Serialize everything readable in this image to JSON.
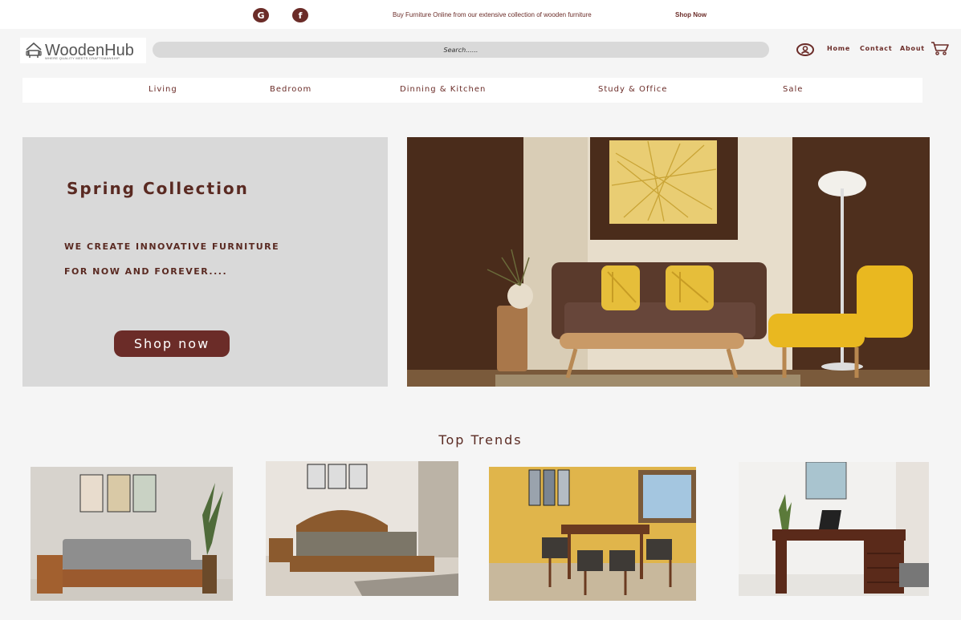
{
  "topbar": {
    "social": [
      {
        "icon": "google-icon",
        "glyph": "G"
      },
      {
        "icon": "facebook-icon",
        "glyph": "f"
      }
    ],
    "promo_text": "Buy Furniture Online from our extensive collection of wooden furniture",
    "shop_now": "Shop Now"
  },
  "header": {
    "logo_text": "WoodenHub",
    "logo_tagline": "WHERE QUALITY MEETS CRAFTSMANSHIP",
    "search_placeholder": "Search......",
    "user_icon": "user-icon",
    "nav": {
      "home": "Home",
      "contact": "Contact",
      "about": "About"
    },
    "cart_icon": "cart-icon"
  },
  "categories": [
    "Living",
    "Bedroom",
    "Dinning & Kitchen",
    "Study & Office",
    "Sale"
  ],
  "hero": {
    "title": "Spring Collection",
    "line1": "WE CREATE INNOVATIVE FURNITURE",
    "line2": "FOR NOW AND FOREVER....",
    "button": "Shop now"
  },
  "trends": {
    "title": "Top Trends",
    "items": [
      "wooden-sofa-image",
      "wooden-bed-image",
      "dining-set-image",
      "study-desk-image"
    ]
  },
  "colors": {
    "brand": "#6b2c28",
    "panel": "#d9d9d9",
    "background": "#f5f5f5"
  }
}
